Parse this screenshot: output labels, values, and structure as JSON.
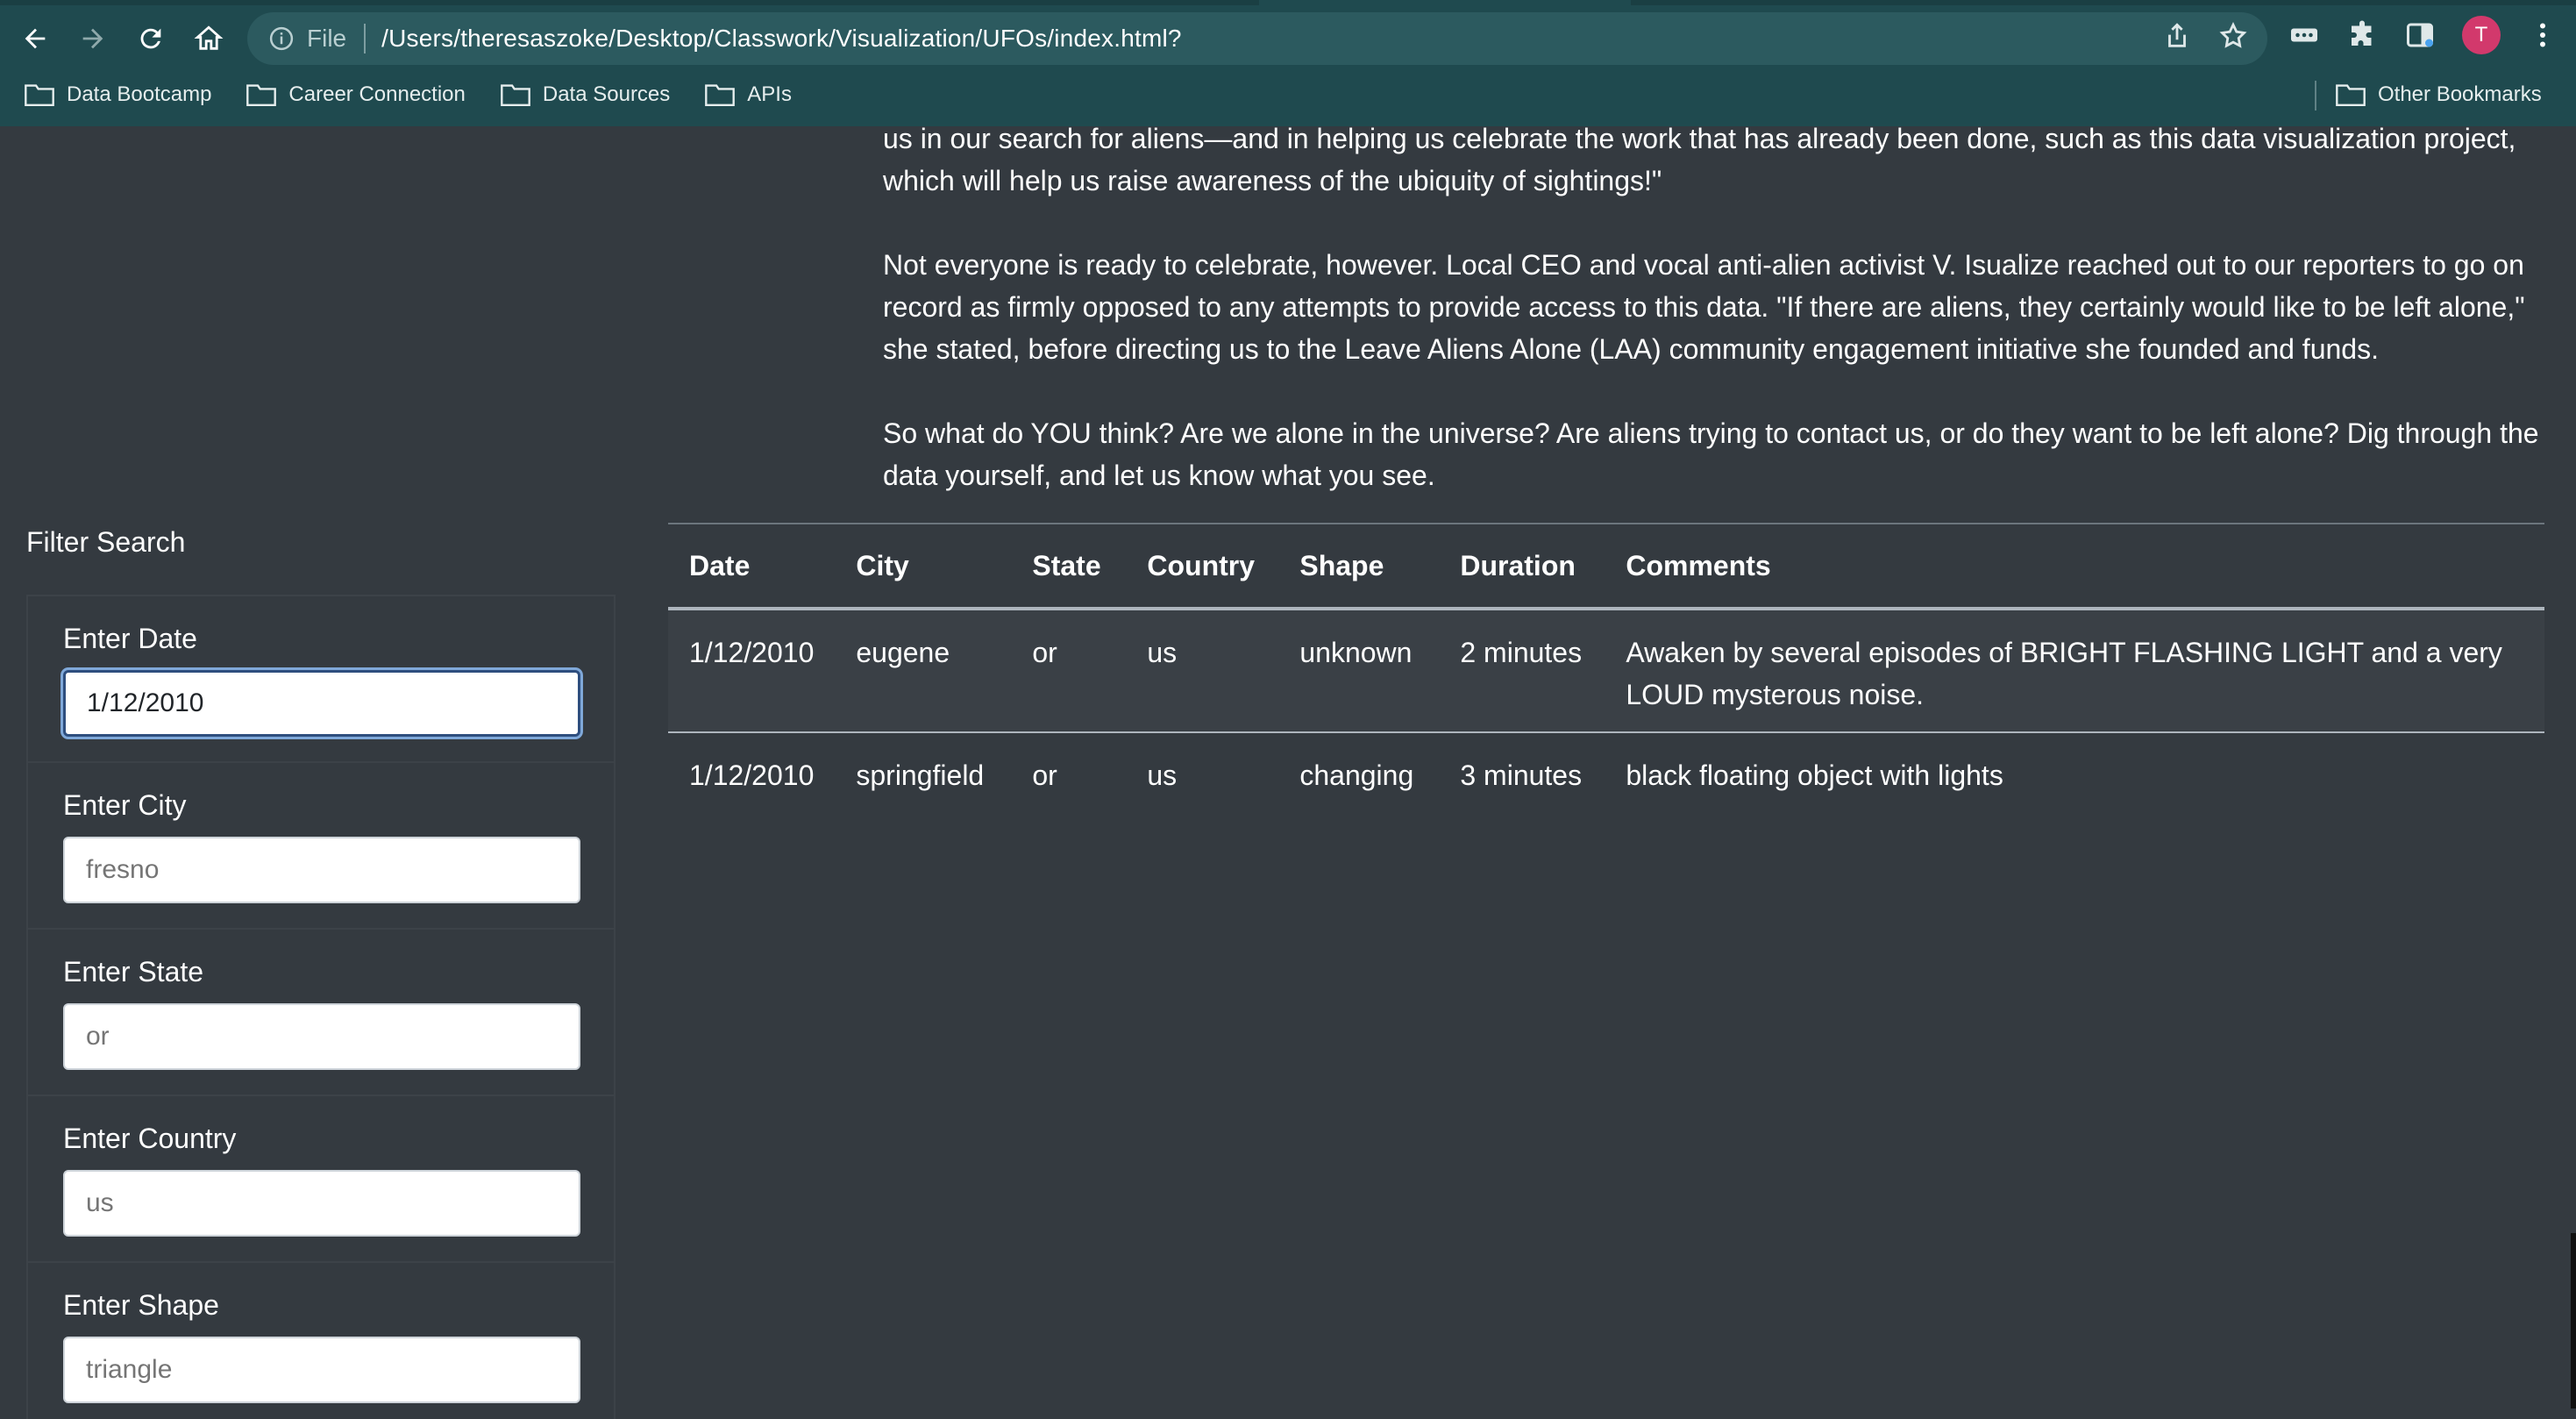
{
  "browser": {
    "file_label": "File",
    "url": "/Users/theresaszoke/Desktop/Classwork/Visualization/UFOs/index.html?",
    "avatar_letter": "T",
    "accent": "#1f4a4f",
    "avatar_color": "#d2396c"
  },
  "bookmarks": {
    "items": [
      "Data Bootcamp",
      "Career Connection",
      "Data Sources",
      "APIs"
    ],
    "other": "Other Bookmarks"
  },
  "article": {
    "p1": "us in our search for aliens—and in helping us celebrate the work that has already been done, such as this data visualization project, which will help us raise awareness of the ubiquity of sightings!\"",
    "p2": "Not everyone is ready to celebrate, however. Local CEO and vocal anti-alien activist V. Isualize reached out to our reporters to go on record as firmly opposed to any attempts to provide access to this data. \"If there are aliens, they certainly would like to be left alone,\" she stated, before directing us to the Leave Aliens Alone (LAA) community engagement initiative she founded and funds.",
    "p3": "So what do YOU think? Are we alone in the universe? Are aliens trying to contact us, or do they want to be left alone? Dig through the data yourself, and let us know what you see."
  },
  "filters": {
    "title": "Filter Search",
    "items": [
      {
        "label": "Enter Date",
        "value": "1/12/2010",
        "placeholder": ""
      },
      {
        "label": "Enter City",
        "value": "",
        "placeholder": "fresno"
      },
      {
        "label": "Enter State",
        "value": "",
        "placeholder": "or"
      },
      {
        "label": "Enter Country",
        "value": "",
        "placeholder": "us"
      },
      {
        "label": "Enter Shape",
        "value": "",
        "placeholder": "triangle"
      }
    ]
  },
  "table": {
    "headers": [
      "Date",
      "City",
      "State",
      "Country",
      "Shape",
      "Duration",
      "Comments"
    ],
    "rows": [
      [
        "1/12/2010",
        "eugene",
        "or",
        "us",
        "unknown",
        "2 minutes",
        "Awaken by several episodes of BRIGHT FLASHING LIGHT and a very LOUD mysterous noise."
      ],
      [
        "1/12/2010",
        "springfield",
        "or",
        "us",
        "changing",
        "3 minutes",
        "black floating object with lights"
      ]
    ]
  }
}
